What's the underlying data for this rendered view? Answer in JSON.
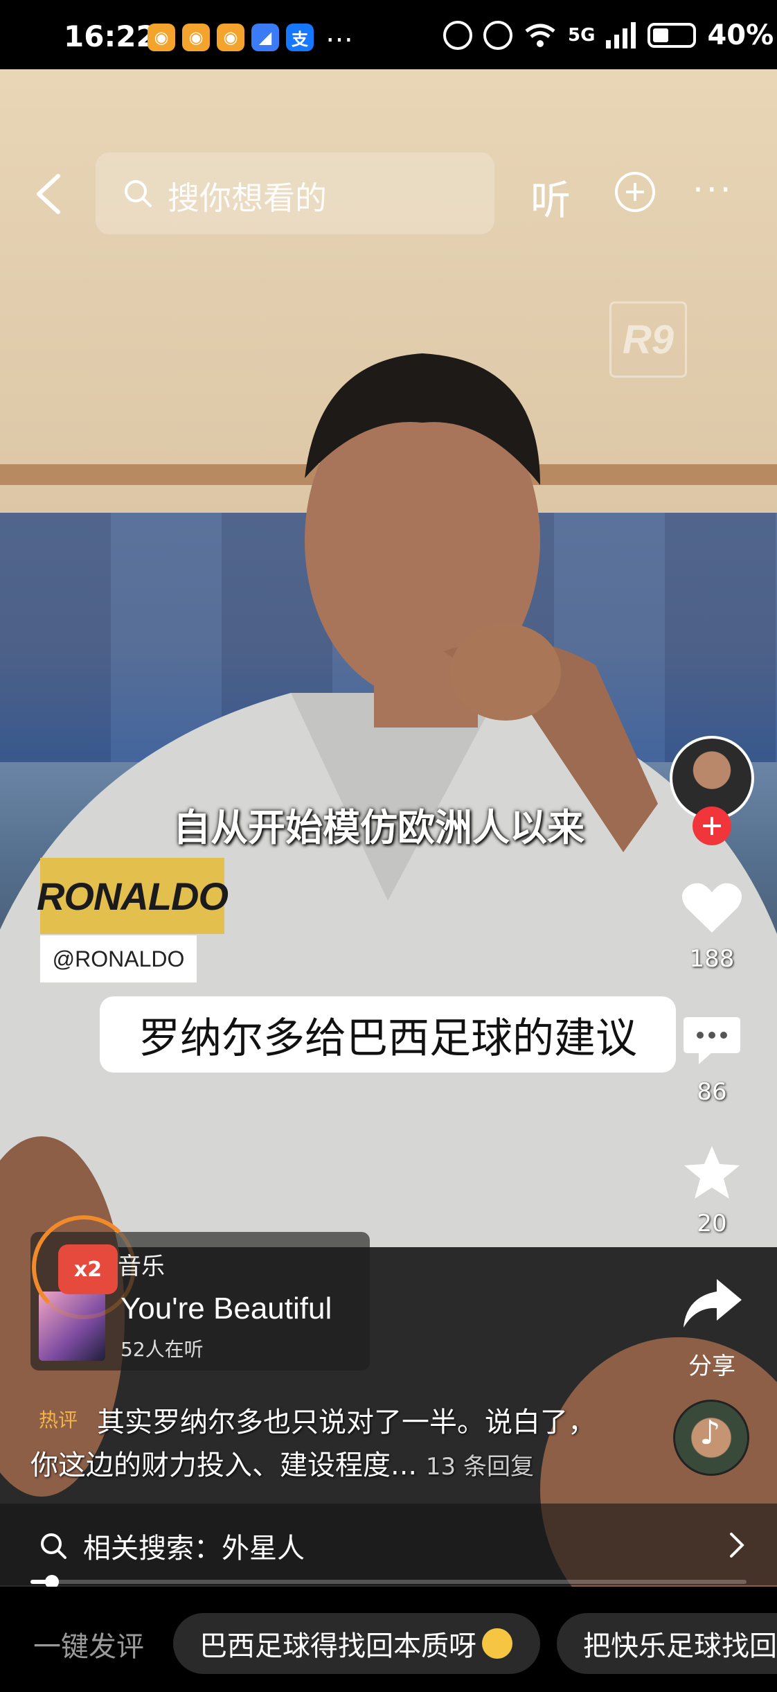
{
  "status_bar": {
    "time": "16:22",
    "apps": [
      {
        "name": "weibo-icon",
        "glyph": "◉",
        "bg": "#f4a32c"
      },
      {
        "name": "weibo-icon",
        "glyph": "◉",
        "bg": "#f4a32c"
      },
      {
        "name": "weibo-icon",
        "glyph": "◉",
        "bg": "#f4a32c"
      },
      {
        "name": "browser-icon",
        "glyph": "◢",
        "bg": "#3b7cf6"
      },
      {
        "name": "alipay-icon",
        "glyph": "支",
        "bg": "#1677ff"
      }
    ],
    "more": "…",
    "network": "5G",
    "battery": "40%"
  },
  "top_bar": {
    "search_placeholder": "搜你想看的",
    "listen_label": "听"
  },
  "video": {
    "watermark": "R9",
    "caption": "自从开始模仿欧洲人以来",
    "name_tag": "RONALDO",
    "handle": "@RONALDO",
    "title": "罗纳尔多给巴西足球的建议"
  },
  "actions": {
    "likes": "188",
    "comments": "86",
    "favorites": "20",
    "share_label": "分享"
  },
  "music": {
    "badge": "x2",
    "tag": "音乐",
    "title": "You're Beautiful",
    "listeners": "52人在听"
  },
  "hot_comment": {
    "tag": "热评",
    "line1": "其实罗纳尔多也只说对了一半。说白了，",
    "line2": "你这边的财力投入、建设程度...",
    "replies": "13 条回复"
  },
  "related_search": {
    "text": "相关搜索：外星人"
  },
  "playback": {
    "progress_fraction": 0.03
  },
  "bottom_bar": {
    "one_key_label": "一键发评",
    "chips": [
      "巴西足球得找回本质呀",
      "把快乐足球找回"
    ]
  },
  "colors": {
    "accent_red": "#f0353b",
    "badge_orange": "#f08a2a",
    "hot_tag": "#f3b44a"
  }
}
